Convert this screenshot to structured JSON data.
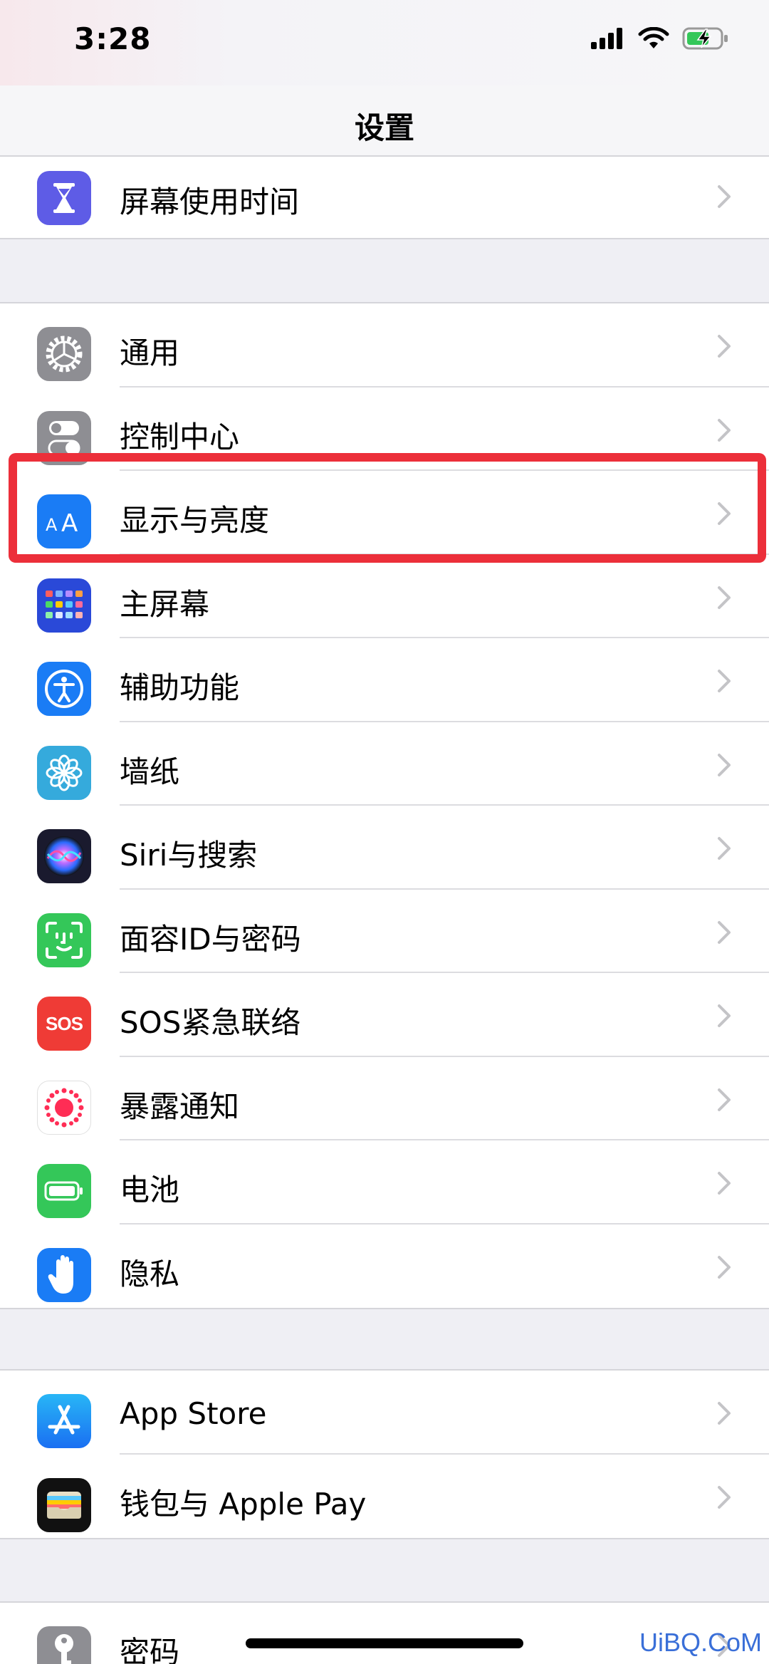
{
  "status_bar": {
    "time": "3:28"
  },
  "nav": {
    "title": "设置"
  },
  "groups": [
    {
      "items": [
        {
          "label": "屏幕使用时间",
          "icon": "hourglass-icon",
          "color": "#5e5ce6"
        }
      ]
    },
    {
      "items": [
        {
          "label": "通用",
          "icon": "gear-icon",
          "color": "#8e8e93"
        },
        {
          "label": "控制中心",
          "icon": "toggle-icon",
          "color": "#8e8e93"
        },
        {
          "label": "显示与亮度",
          "icon": "text-size-icon",
          "color": "#1a7cf5",
          "glyph": "AA"
        },
        {
          "label": "主屏幕",
          "icon": "home-screen-icon",
          "color": "#2a49d8"
        },
        {
          "label": "辅助功能",
          "icon": "accessibility-icon",
          "color": "#1a7cf5"
        },
        {
          "label": "墙纸",
          "icon": "flower-icon",
          "color": "#35aadc"
        },
        {
          "label": "Siri与搜索",
          "icon": "siri-icon",
          "color": "#1a1a2e"
        },
        {
          "label": "面容ID与密码",
          "icon": "face-id-icon",
          "color": "#34c759"
        },
        {
          "label": "SOS紧急联络",
          "icon": "sos-icon",
          "color": "#ef3b36",
          "glyph": "SOS"
        },
        {
          "label": "暴露通知",
          "icon": "exposure-icon",
          "color": "#ffffff"
        },
        {
          "label": "电池",
          "icon": "battery-icon",
          "color": "#34c759"
        },
        {
          "label": "隐私",
          "icon": "hand-icon",
          "color": "#1a7cf5"
        }
      ]
    },
    {
      "items": [
        {
          "label": "App Store",
          "icon": "app-store-icon",
          "color": "#1c8ef5"
        },
        {
          "label": "钱包与 Apple Pay",
          "icon": "wallet-icon",
          "color": "#111111"
        }
      ]
    },
    {
      "items": [
        {
          "label": "密码",
          "icon": "key-icon",
          "color": "#8e8e93"
        }
      ]
    }
  ],
  "watermark": "UiBQ.CoM",
  "highlight_color": "#ec2f3a"
}
